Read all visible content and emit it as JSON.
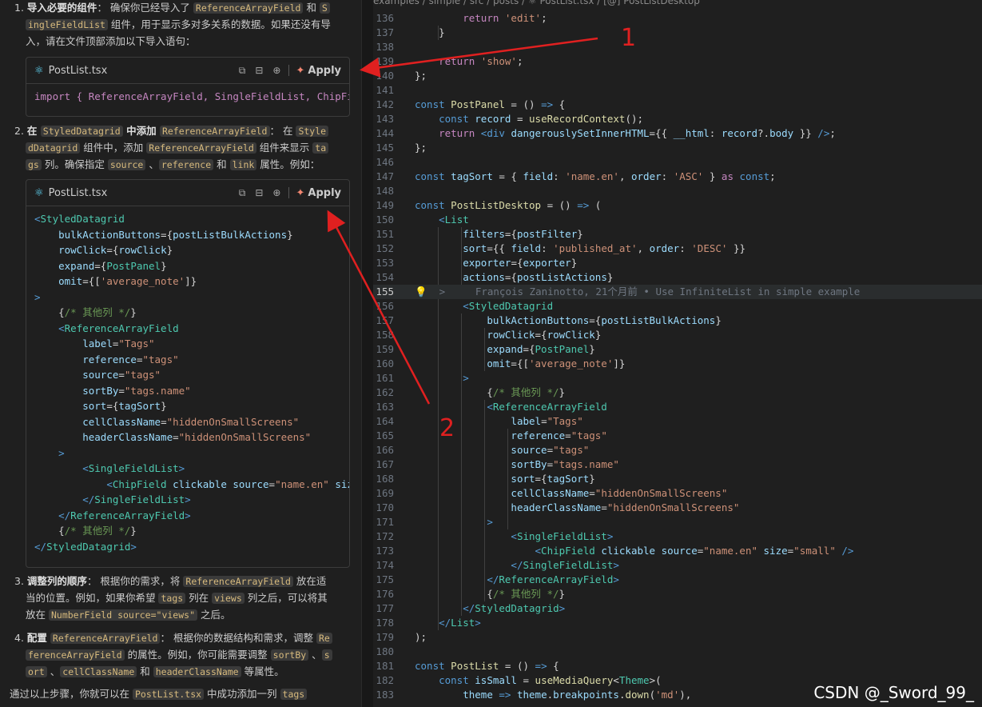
{
  "chat": {
    "step1": {
      "num": "1.",
      "title": "导入必要的组件",
      "colon": "：",
      "t1": " 确保你已经导入了 ",
      "c1": "ReferenceArrayField",
      "t2": " 和 ",
      "c2a": "S",
      "c2b": "ingleFieldList",
      "t3": " 组件，用于显示多对多关系的数据。如果还没有导",
      "t4": "入，请在文件顶部添加以下导入语句："
    },
    "card1": {
      "filename": "PostList.tsx",
      "apply": "Apply",
      "code": "import { ReferenceArrayField, SingleFieldList, ChipFie"
    },
    "step2": {
      "num": "2.",
      "l1a": "在 ",
      "l1c1": "StyledDatagrid",
      "l1b": " 中添加 ",
      "l1c2": "ReferenceArrayField",
      "l1d": "：  在 ",
      "l1c3": "Style",
      "l2c1": "dDatagrid",
      "l2a": " 组件中，添加 ",
      "l2c2": "ReferenceArrayField",
      "l2b": " 组件来显示 ",
      "l2c3": "ta",
      "l3c1": "gs",
      "l3a": " 列。确保指定 ",
      "l3c2": "source",
      "l3b": " 、",
      "l3c3": "reference",
      "l3d": " 和 ",
      "l3c4": "link",
      "l3e": " 属性。例如："
    },
    "card2": {
      "filename": "PostList.tsx",
      "apply": "Apply"
    },
    "step3": {
      "num": "3.",
      "title": "调整列的顺序",
      "t1": "：  根据你的需求，将 ",
      "c1": "ReferenceArrayField",
      "t2": " 放在适",
      "t3": "当的位置。例如，如果你希望 ",
      "c2": "tags",
      "t4": " 列在 ",
      "c3": "views",
      "t5": " 列之后，可以将其",
      "t6": "放在 ",
      "c4": "NumberField source=\"views\"",
      "t7": " 之后。"
    },
    "step4": {
      "num": "4.",
      "title": "配置",
      "c1": "ReferenceArrayField",
      "t1": "：  根据你的数据结构和需求，调整 ",
      "c2": "Re",
      "c3": "ferenceArrayField",
      "t2": " 的属性。例如，你可能需要调整 ",
      "c4": "sortBy",
      "t3": " 、",
      "c5": "s",
      "c6": "ort",
      "t4": " 、",
      "c7": "cellClassName",
      "t5": " 和 ",
      "c8": "headerClassName",
      "t6": " 等属性。"
    },
    "footer": {
      "t1": "通过以上步骤，你就可以在 ",
      "c1": "PostList.tsx",
      "t2": " 中成功添加一列 ",
      "c2": "tags"
    }
  },
  "editor": {
    "breadcrumb": "examples / simple / src / posts / ⚛ PostList.tsx / [@] PostListDesktop",
    "blame": "François Zaninotto, 21个月前 • Use InfiniteList in simple example",
    "current_line": "155",
    "line_numbers": [
      "136",
      "137",
      "138",
      "139",
      "140",
      "141",
      "142",
      "143",
      "144",
      "145",
      "146",
      "147",
      "148",
      "149",
      "150",
      "151",
      "152",
      "153",
      "154",
      "155",
      "156",
      "157",
      "158",
      "159",
      "160",
      "161",
      "162",
      "163",
      "164",
      "165",
      "166",
      "167",
      "168",
      "169",
      "170",
      "171",
      "172",
      "173",
      "174",
      "175",
      "176",
      "177",
      "178",
      "179",
      "180",
      "181",
      "182",
      "183"
    ]
  },
  "annotations": {
    "label1": "1",
    "label2": "2",
    "arrow_color": "#e02020"
  },
  "watermark": "CSDN @_Sword_99_"
}
